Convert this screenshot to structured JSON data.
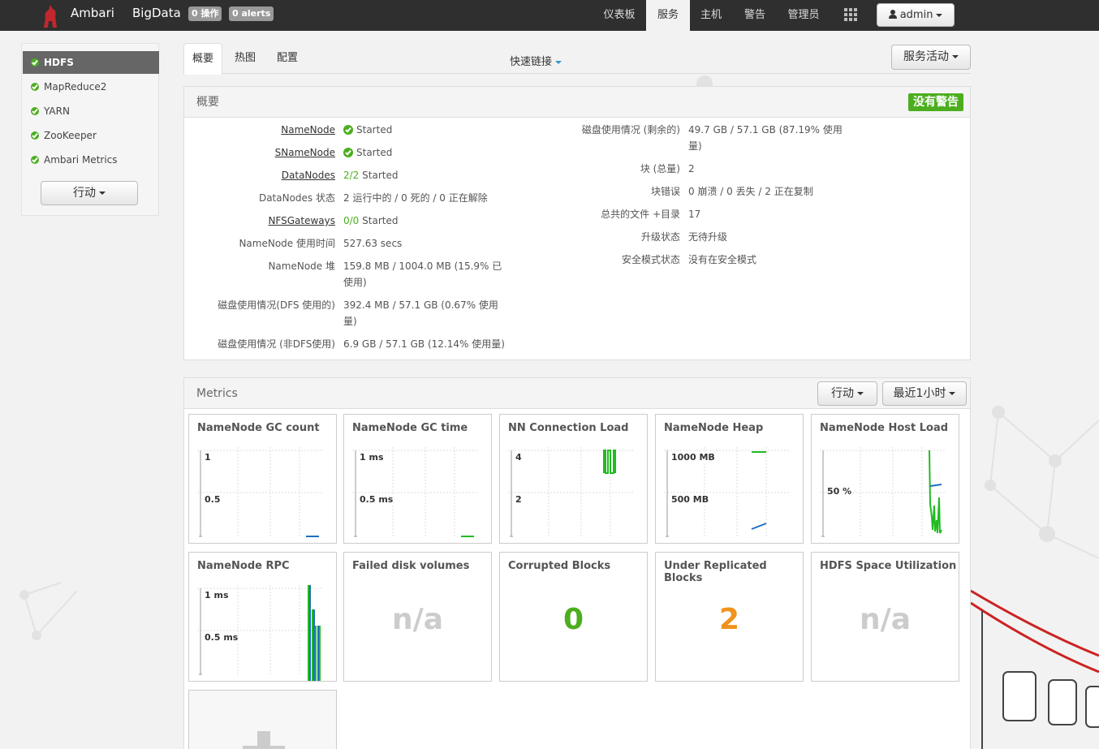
{
  "topbar": {
    "brand": "Ambari",
    "cluster": "BigData",
    "ops_badge": "0 操作",
    "alerts_badge": "0 alerts",
    "nav": [
      "仪表板",
      "服务",
      "主机",
      "警告",
      "管理员"
    ],
    "active_nav": "服务",
    "user": "admin"
  },
  "sidebar": {
    "items": [
      "HDFS",
      "MapReduce2",
      "YARN",
      "ZooKeeper",
      "Ambari Metrics"
    ],
    "active": "HDFS",
    "action": "行动"
  },
  "tabs": {
    "items": [
      "概要",
      "热图",
      "配置"
    ],
    "active": "概要",
    "quick_links": "快速链接",
    "service_action": "服务活动"
  },
  "summary": {
    "title": "概要",
    "badge": "没有警告",
    "left": [
      {
        "label": "NameNode",
        "value": "Started",
        "link": true,
        "status": "ok"
      },
      {
        "label": "SNameNode",
        "value": "Started",
        "link": true,
        "status": "ok"
      },
      {
        "label": "DataNodes",
        "value_green": "2/2",
        "value": "Started",
        "link": true
      },
      {
        "label": "DataNodes 状态",
        "value": "2 运行中的 / 0 死的 / 0 正在解除"
      },
      {
        "label": "NFSGateways",
        "value_green": "0/0",
        "value": "Started",
        "link": true
      },
      {
        "label": "NameNode 使用时间",
        "value": "527.63 secs"
      },
      {
        "label": "NameNode 堆",
        "value": "159.8 MB / 1004.0 MB (15.9% 已",
        "value2": "使用)"
      },
      {
        "label": "磁盘使用情况(DFS 使用的)",
        "value": "392.4 MB / 57.1 GB (0.67% 使用",
        "value2": "量)"
      },
      {
        "label": "磁盘使用情况 (非DFS使用)",
        "value": "6.9 GB / 57.1 GB (12.14% 使用量)"
      }
    ],
    "right": [
      {
        "label": "磁盘使用情况 (剩余的)",
        "value": "49.7 GB / 57.1 GB (87.19% 使用",
        "value2": "量)"
      },
      {
        "label": "块 (总量)",
        "value": "2"
      },
      {
        "label": "块错误",
        "value": "0 崩溃 / 0 丢失 / 2 正在复制"
      },
      {
        "label": "总共的文件 +目录",
        "value": "17"
      },
      {
        "label": "升级状态",
        "value": "无待升级"
      },
      {
        "label": "安全模式状态",
        "value": "没有在安全模式"
      }
    ]
  },
  "metrics": {
    "title": "Metrics",
    "action": "行动",
    "range": "最近1小时",
    "widgets": [
      {
        "title": "NameNode GC count",
        "kind": "chart",
        "ticks": [
          "1",
          "0.5"
        ]
      },
      {
        "title": "NameNode GC time",
        "kind": "chart",
        "ticks": [
          "1 ms",
          "0.5 ms"
        ]
      },
      {
        "title": "NN Connection Load",
        "kind": "chart",
        "ticks": [
          "4",
          "2"
        ]
      },
      {
        "title": "NameNode Heap",
        "kind": "chart",
        "ticks": [
          "1000 MB",
          "500 MB"
        ]
      },
      {
        "title": "NameNode Host Load",
        "kind": "chart",
        "ticks": [
          "50 %"
        ]
      },
      {
        "title": "NameNode RPC",
        "kind": "chart",
        "ticks": [
          "1 ms",
          "0.5 ms"
        ]
      },
      {
        "title": "Failed disk volumes",
        "kind": "value",
        "value": "n/a",
        "color": "#cccccc"
      },
      {
        "title": "Corrupted Blocks",
        "kind": "value",
        "value": "0",
        "color": "#4cae1f"
      },
      {
        "title": "Under Replicated Blocks",
        "kind": "value",
        "value": "2",
        "color": "#f0921e"
      },
      {
        "title": "HDFS Space Utilization",
        "kind": "value",
        "value": "n/a",
        "color": "#cccccc"
      }
    ]
  },
  "colors": {
    "topbar": "#2f2f2f",
    "ok": "#4cae1f",
    "warn": "#f0921e",
    "series_green": "#22bb22",
    "series_blue": "#1f6fbf"
  }
}
